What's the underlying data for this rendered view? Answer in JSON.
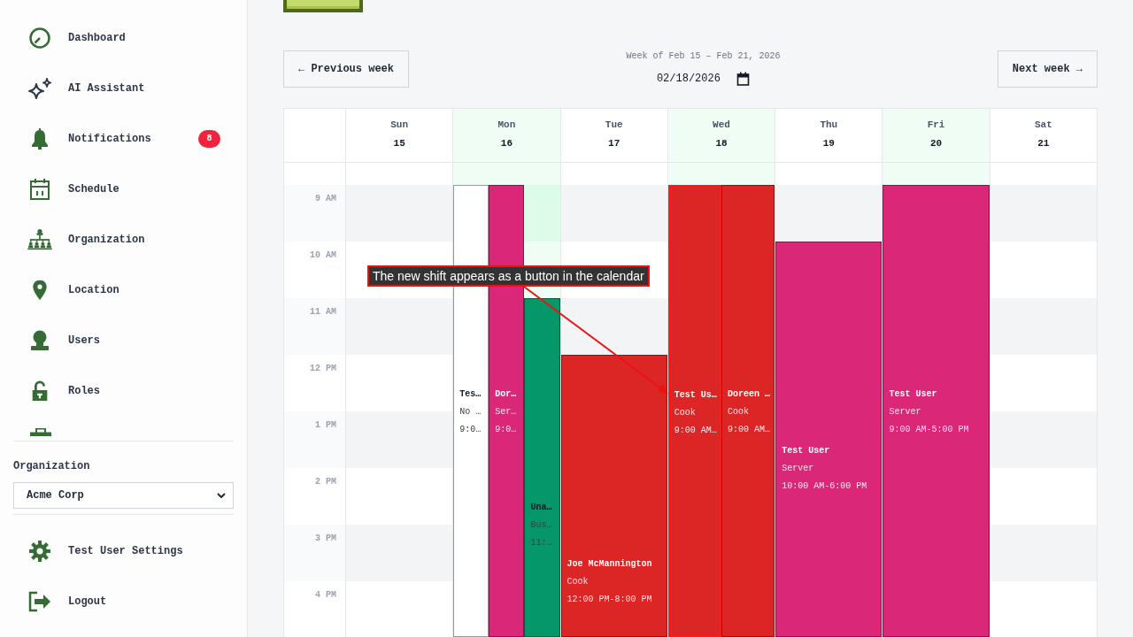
{
  "sidebar": {
    "items": [
      {
        "label": "Dashboard"
      },
      {
        "label": "AI Assistant"
      },
      {
        "label": "Notifications",
        "badge": "8"
      },
      {
        "label": "Schedule"
      },
      {
        "label": "Organization"
      },
      {
        "label": "Location"
      },
      {
        "label": "Users"
      },
      {
        "label": "Roles"
      }
    ],
    "organization": {
      "label": "Organization",
      "value": "Acme Corp"
    },
    "footer_items": [
      {
        "label": "Test User Settings"
      },
      {
        "label": "Logout"
      }
    ]
  },
  "toolbar": {
    "previous_button": "← Previous week",
    "week_label": "Week of Feb 15 – Feb 21, 2026",
    "date_value": "02/18/2026",
    "next_button": "Next week →"
  },
  "calendar": {
    "hours": [
      "9 AM",
      "10 AM",
      "11 AM",
      "12 PM",
      "1 PM",
      "2 PM",
      "3 PM",
      "4 PM"
    ],
    "days": [
      {
        "name": "Sun",
        "date": "15",
        "highlighted": false
      },
      {
        "name": "Mon",
        "date": "16",
        "highlighted": true,
        "events": [
          {
            "title": "Tes…",
            "role": "No …",
            "time": "9:0…",
            "color": "#ffffff",
            "annotated": false
          },
          {
            "title": "Dor…",
            "role": "Ser…",
            "time": "9:0…",
            "color": "#db2777",
            "annotated": false
          },
          {
            "title": "Una…",
            "role": "Bus…",
            "time": "11:…",
            "color": "#059669",
            "annotated": false
          }
        ]
      },
      {
        "name": "Tue",
        "date": "17",
        "highlighted": false,
        "events": [
          {
            "title": "Joe McMannington",
            "role": "Cook",
            "time": "12:00 PM-8:00 PM",
            "color": "#dc2626",
            "annotated": false
          }
        ]
      },
      {
        "name": "Wed",
        "date": "18",
        "highlighted": true,
        "events": [
          {
            "title": "Test Us…",
            "role": "Cook",
            "time": "9:00 AM…",
            "color": "#dc2626",
            "annotated": true
          },
          {
            "title": "Doreen …",
            "role": "Cook",
            "time": "9:00 AM…",
            "color": "#dc2626",
            "annotated": false
          }
        ]
      },
      {
        "name": "Thu",
        "date": "19",
        "highlighted": false,
        "events": [
          {
            "title": "Test User",
            "role": "Server",
            "time": "10:00 AM-6:00 PM",
            "color": "#db2777",
            "annotated": false
          }
        ]
      },
      {
        "name": "Fri",
        "date": "20",
        "highlighted": true,
        "events": [
          {
            "title": "Test User",
            "role": "Server",
            "time": "9:00 AM-5:00 PM",
            "color": "#db2777",
            "annotated": false
          }
        ]
      },
      {
        "name": "Sat",
        "date": "21",
        "highlighted": false
      }
    ]
  },
  "annotation": {
    "text": "The new shift appears as a button in the calendar"
  }
}
